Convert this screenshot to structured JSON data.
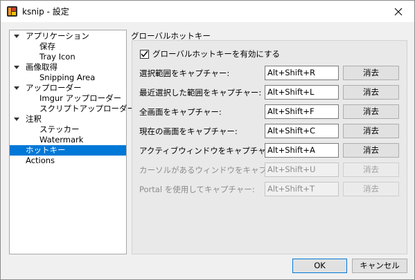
{
  "window": {
    "title": "ksnip - 設定"
  },
  "tree": {
    "items": [
      {
        "label": "アプリケーション",
        "level": 0,
        "expanded": true
      },
      {
        "label": "保存",
        "level": 1
      },
      {
        "label": "Tray Icon",
        "level": 1
      },
      {
        "label": "画像取得",
        "level": 0,
        "expanded": true
      },
      {
        "label": "Snipping Area",
        "level": 1
      },
      {
        "label": "アップローダー",
        "level": 0,
        "expanded": true
      },
      {
        "label": "Imgur アップローダー",
        "level": 1
      },
      {
        "label": "スクリプトアップローダー",
        "level": 1
      },
      {
        "label": "注釈",
        "level": 0,
        "expanded": true
      },
      {
        "label": "ステッカー",
        "level": 1
      },
      {
        "label": "Watermark",
        "level": 1
      },
      {
        "label": "ホットキー",
        "level": 0,
        "selected": true
      },
      {
        "label": "Actions",
        "level": 0
      }
    ]
  },
  "hotkeys": {
    "group_title": "グローバルホットキー",
    "enable_label": "グローバルホットキーを有効にする",
    "enabled": true,
    "clear_label": "消去",
    "rows": [
      {
        "label": "選択範囲をキャプチャー:",
        "value": "Alt+Shift+R",
        "disabled": false
      },
      {
        "label": "最近選択した範囲をキャプチャー:",
        "value": "Alt+Shift+L",
        "disabled": false
      },
      {
        "label": "全画面をキャプチャー:",
        "value": "Alt+Shift+F",
        "disabled": false
      },
      {
        "label": "現在の画面をキャプチャー:",
        "value": "Alt+Shift+C",
        "disabled": false
      },
      {
        "label": "アクティブウィンドウをキャプチャー:",
        "value": "Alt+Shift+A",
        "disabled": false
      },
      {
        "label": "カーソルがあるウィンドウをキャプチャー:",
        "value": "Alt+Shift+U",
        "disabled": true
      },
      {
        "label": "Portal を使用してキャプチャー:",
        "value": "Alt+Shift+T",
        "disabled": true
      }
    ]
  },
  "footer": {
    "ok_label": "OK",
    "cancel_label": "キャンセル"
  },
  "colors": {
    "selection": "#0078d7",
    "accent_border": "#0078d7"
  }
}
